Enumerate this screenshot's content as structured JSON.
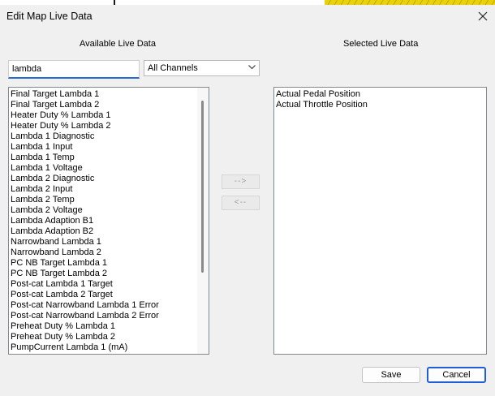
{
  "window": {
    "title": "Edit Map Live Data"
  },
  "available": {
    "header": "Available Live Data",
    "search_value": "lambda",
    "channel_filter": "All Channels",
    "items": [
      "Final Target Lambda 1",
      "Final Target Lambda 2",
      "Heater Duty % Lambda 1",
      "Heater Duty % Lambda 2",
      "Lambda 1 Diagnostic",
      "Lambda 1 Input",
      "Lambda 1 Temp",
      "Lambda 1 Voltage",
      "Lambda 2 Diagnostic",
      "Lambda 2 Input",
      "Lambda 2 Temp",
      "Lambda 2 Voltage",
      "Lambda Adaption B1",
      "Lambda Adaption B2",
      "Narrowband Lambda 1",
      "Narrowband Lambda 2",
      "PC NB Target Lambda 1",
      "PC NB Target Lambda 2",
      "Post-cat Lambda 1 Target",
      "Post-cat Lambda 2 Target",
      "Post-cat Narrowband Lambda 1 Error",
      "Post-cat Narrowband Lambda 2 Error",
      "Preheat Duty % Lambda 1",
      "Preheat Duty % Lambda 2",
      "PumpCurrent Lambda 1 (mA)"
    ]
  },
  "selected": {
    "header": "Selected Live Data",
    "items": [
      "Actual Pedal Position",
      "Actual Throttle Position"
    ]
  },
  "transfer": {
    "add_label": "-->",
    "remove_label": "<--"
  },
  "footer": {
    "save_label": "Save",
    "cancel_label": "Cancel"
  }
}
